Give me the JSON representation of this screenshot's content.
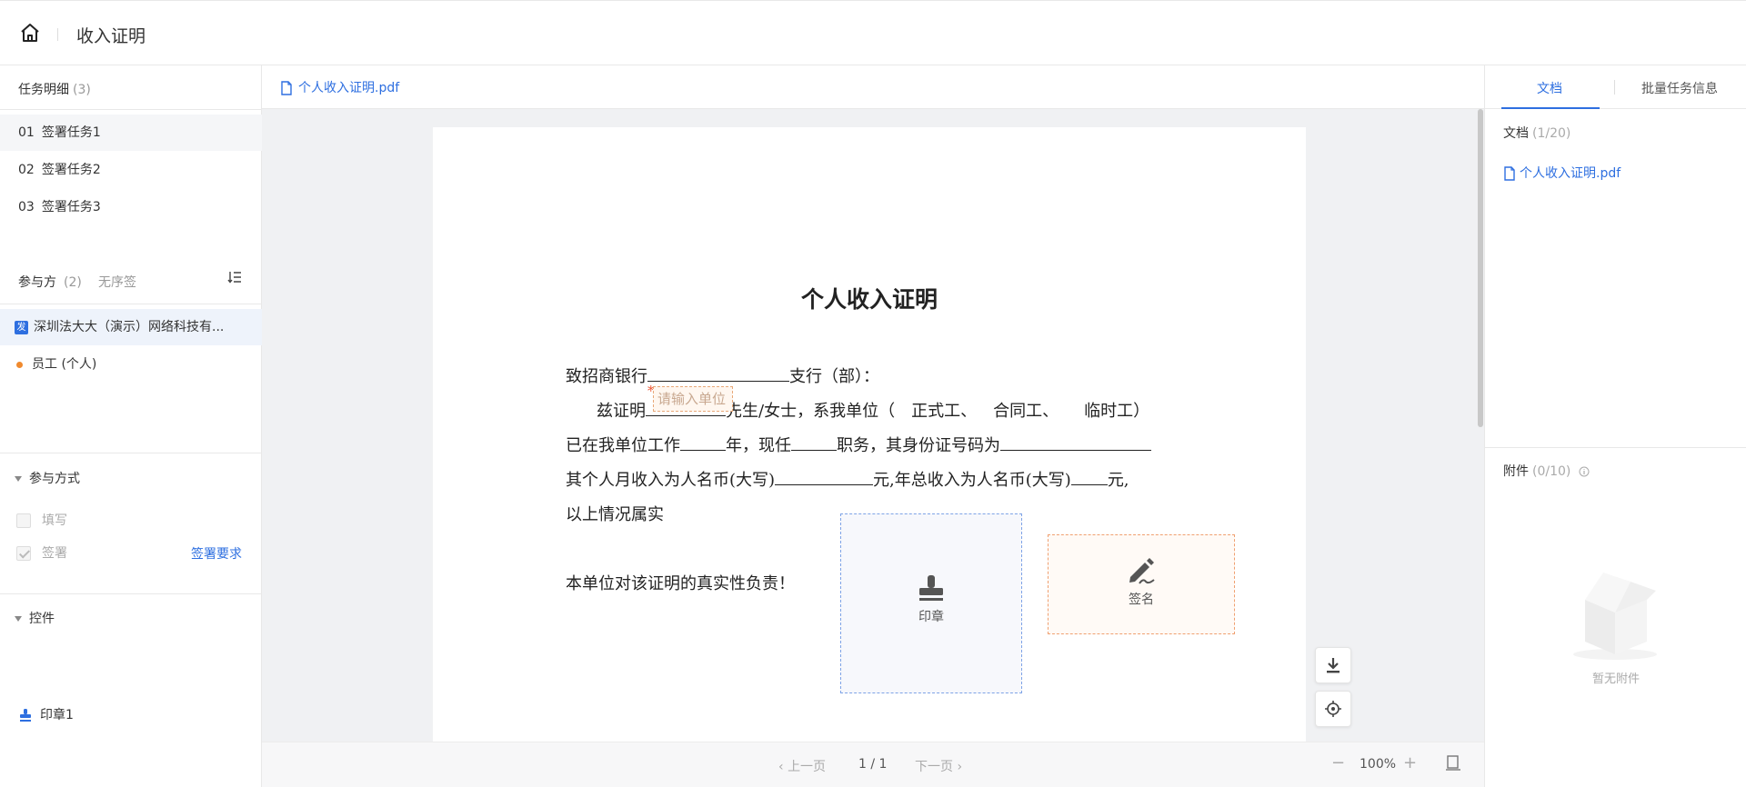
{
  "header": {
    "title": "收入证明",
    "home_icon": "home-icon"
  },
  "left": {
    "tasks_title": "任务明细",
    "tasks_count": "(3)",
    "tasks": [
      {
        "num": "01",
        "label": "签署任务1"
      },
      {
        "num": "02",
        "label": "签署任务2"
      },
      {
        "num": "03",
        "label": "签署任务3"
      }
    ],
    "parties_title": "参与方",
    "parties_count": "(2)",
    "parties_mode": "无序签",
    "parties": [
      {
        "badge": "发",
        "name": "深圳法大大（演示）网络科技有..."
      },
      {
        "name": "员工 (个人)"
      }
    ],
    "participation_title": "参与方式",
    "options": [
      {
        "label": "填写",
        "checked": false
      },
      {
        "label": "签署",
        "checked": true
      }
    ],
    "sign_requirement": "签署要求",
    "controls_title": "控件",
    "control_item": "印章1"
  },
  "center": {
    "file_tab": "个人收入证明.pdf",
    "document": {
      "title": "个人收入证明",
      "line1_a": "致招商银行",
      "line1_b": "支行（部）：",
      "line2_a": "兹证明",
      "line2_b": "先生/女士，系我单位（",
      "line2_c": "正式工、",
      "line2_d": "合同工、",
      "line2_e": "临时工）",
      "line3_a": "已在我单位工作",
      "line3_b": "年，现任",
      "line3_c": "职务，其身份证号码为",
      "line4_a": "其个人月收入为人名币(大写)",
      "line4_b": "元,年总收入为人名币(大写)",
      "line4_c": "元,",
      "line5": "以上情况属实",
      "line6": "本单位对该证明的真实性负责！",
      "input_placeholder": "请输入单位",
      "required_mark": "*",
      "seal_label": "印章",
      "signature_label": "签名"
    },
    "pager": {
      "prev": "上一页",
      "page": "1 / 1",
      "next": "下一页",
      "zoom": "100%"
    }
  },
  "right": {
    "tab_doc": "文档",
    "tab_batch": "批量任务信息",
    "docs_title": "文档",
    "docs_count": "(1/20)",
    "doc_file": "个人收入证明.pdf",
    "attach_title": "附件",
    "attach_count": "(0/10)",
    "empty_text": "暂无附件"
  },
  "colors": {
    "accent": "#2e6fe0",
    "signature_border": "#f0a070",
    "seal_border": "#7ea3e6",
    "party_dot": "#f08a2e"
  }
}
